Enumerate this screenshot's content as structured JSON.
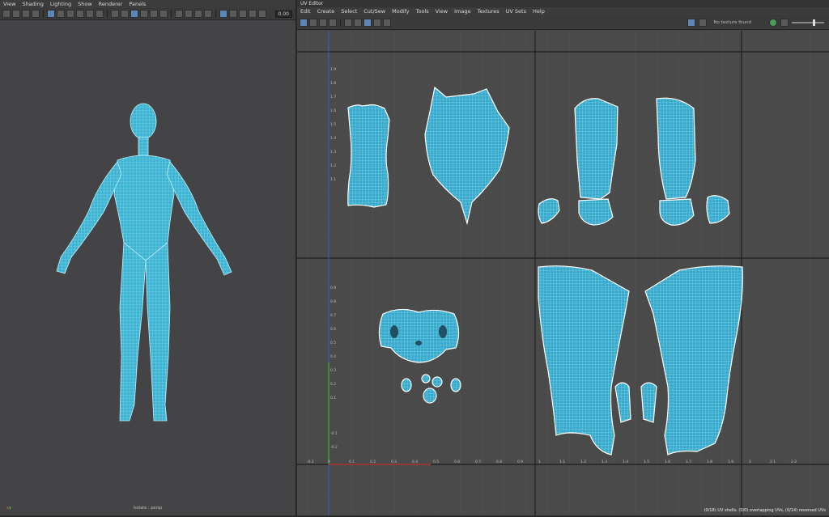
{
  "main_menu": [
    "View",
    "Shading",
    "Lighting",
    "Show",
    "Renderer",
    "Panels"
  ],
  "viewport": {
    "value_field": "0.00",
    "caption": "Isolate : persp"
  },
  "uv_editor": {
    "title": "UV Editor",
    "menu": [
      "Edit",
      "Create",
      "Select",
      "Cut/Sew",
      "Modify",
      "Tools",
      "View",
      "Image",
      "Textures",
      "UV Sets",
      "Help"
    ],
    "texture_label": "No texture found",
    "status": "(0/18) UV shells, (0/0) overlapping UVs, (0/14) reversed UVs",
    "y_ticks": [
      "1.9",
      "1.8",
      "1.7",
      "1.6",
      "1.5",
      "1.4",
      "1.3",
      "1.2",
      "1.1",
      "0.9",
      "0.8",
      "0.7",
      "0.6",
      "0.5",
      "0.4",
      "0.3",
      "0.2",
      "0.1",
      "-0.1",
      "-0.2"
    ],
    "x_ticks": [
      "-0.1",
      "0",
      "0.1",
      "0.2",
      "0.3",
      "0.4",
      "0.5",
      "0.6",
      "0.7",
      "0.8",
      "0.9",
      "1",
      "1.1",
      "1.2",
      "1.3",
      "1.4",
      "1.5",
      "1.6",
      "1.7",
      "1.8",
      "1.9",
      "2",
      "2.1",
      "2.2"
    ]
  },
  "colors": {
    "wire": "#7fe0f5",
    "fill": "#3fb3d2",
    "bg": "#4a4a4a"
  }
}
